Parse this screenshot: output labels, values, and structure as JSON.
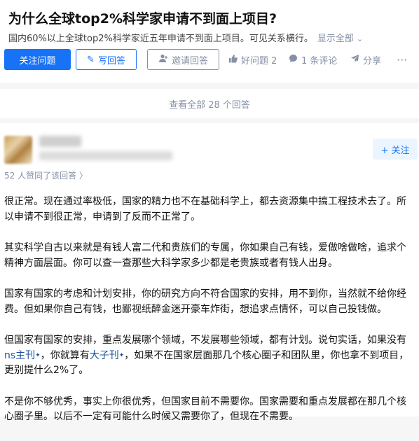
{
  "question": {
    "title": "为什么全球top2%科学家申请不到面上项目?",
    "detail": "国内60%以上全球top2%科学家近五年申请不到面上项目。可见关系横行。",
    "show_all": "显示全部",
    "chevron": "chevron-down-icon"
  },
  "actions": {
    "follow_question": "关注问题",
    "write_answer": "写回答",
    "invite_answer": "邀请回答",
    "good_question": "好问题 2",
    "comments": "1 条评论",
    "share": "分享",
    "more": "···"
  },
  "view_all": "查看全部 28 个回答",
  "answer": {
    "follow_label": "+ 关注",
    "upvotes": "52 人赞同了该回答 〉",
    "paragraphs": [
      {
        "text": "很正常。现在通过率极低，国家的精力也不在基础科学上，都去资源集中搞工程技术去了。所以申请不到很正常，申请到了反而不正常了。"
      },
      {
        "text": "其实科学自古以来就是有钱人富二代和贵族们的专属，你如果自己有钱，爱做啥做啥，追求个精神方面层面。你可以查一查那些大科学家多少都是老贵族或者有钱人出身。"
      },
      {
        "text": "国家有国家的考虑和计划安排，你的研究方向不符合国家的安排，用不到你，当然就不给你经费。但如果你自己有钱，也鄙视纸醉金迷开豪车炸街，想追求点情怀，可以自己投钱做。"
      }
    ],
    "p4": {
      "part1": "但国家有国家的安排，重点发展哪个领域，不发展哪些领域，都有计划。说句实话，如果没有",
      "link1": "ns主刊",
      "part2": "，你就算有",
      "link2": "大子刊",
      "part3": "，如果不在国家层面那几个核心圈子和团队里，你也拿不到项目，更别提什么2%了。",
      "spark": "✦"
    },
    "p5": "不是你不够优秀，事实上你很优秀，但国家目前不需要你。国家需要和重点发展都在那几个核心圈子里。以后不一定有可能什么时候又需要你了，但现在不需要。"
  },
  "colors": {
    "brand": "#1772f6",
    "muted": "#8590a6",
    "link": "#175199"
  }
}
